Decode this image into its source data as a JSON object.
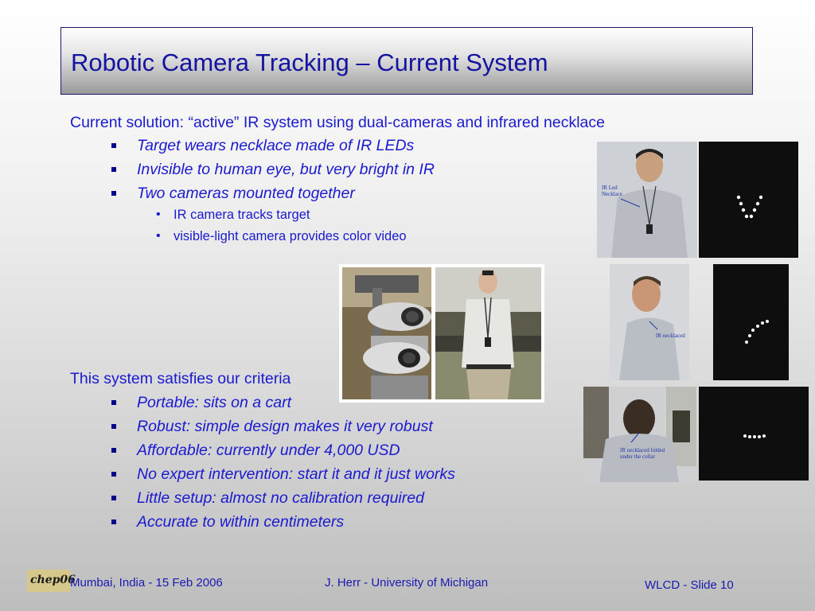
{
  "slide": {
    "title": "Robotic Camera Tracking – Current System",
    "section1": {
      "heading": "Current solution: “active” IR system using dual-cameras and infrared necklace",
      "bullets": [
        "Target wears necklace made of IR LEDs",
        "Invisible to human eye, but very bright in IR",
        "Two cameras mounted together"
      ],
      "subbullets": [
        "IR camera tracks target",
        "visible-light camera provides color video"
      ]
    },
    "section2": {
      "heading": "This system satisfies our criteria",
      "bullets": [
        "Portable: sits on a cart",
        "Robust: simple design makes it very robust",
        "Affordable: currently under 4,000 USD",
        "No expert intervention: start it and it just works",
        "Little setup: almost no calibration required",
        "Accurate to within centimeters"
      ]
    },
    "photo_labels": {
      "p1": [
        "IR Led",
        "Necklace"
      ],
      "p2": "IR necklaced",
      "p3": [
        "IR necklaced folded",
        "under the collar"
      ]
    },
    "footer": {
      "logo": "chep06",
      "left": "Mumbai, India - 15 Feb 2006",
      "center": "J. Herr - University of Michigan",
      "right": "WLCD - Slide 10"
    },
    "colors": {
      "title": "#1414a0",
      "text": "#1a1ad0",
      "bullet": "#00008a"
    }
  }
}
